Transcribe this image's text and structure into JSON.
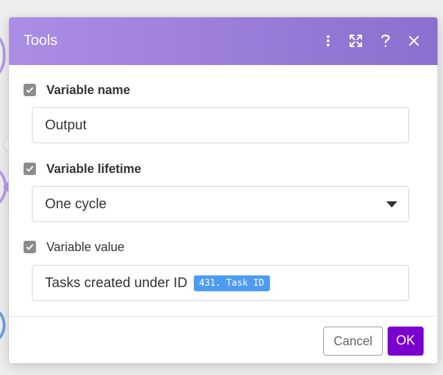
{
  "dialog": {
    "title": "Tools",
    "header_icons": [
      "more-vertical-icon",
      "expand-icon",
      "help-icon",
      "close-icon"
    ],
    "header_gradient": [
      "#ab8de6",
      "#8c6fce"
    ]
  },
  "fields": {
    "variable_name": {
      "label": "Variable name",
      "value": "Output"
    },
    "variable_lifetime": {
      "label": "Variable lifetime",
      "value": "One cycle"
    },
    "variable_value": {
      "label": "Variable value",
      "text": "Tasks created under ID",
      "token": "431. Task ID",
      "token_color": "#4e9bf2"
    }
  },
  "footer": {
    "cancel_label": "Cancel",
    "ok_label": "OK",
    "ok_color": "#7a00d0"
  }
}
